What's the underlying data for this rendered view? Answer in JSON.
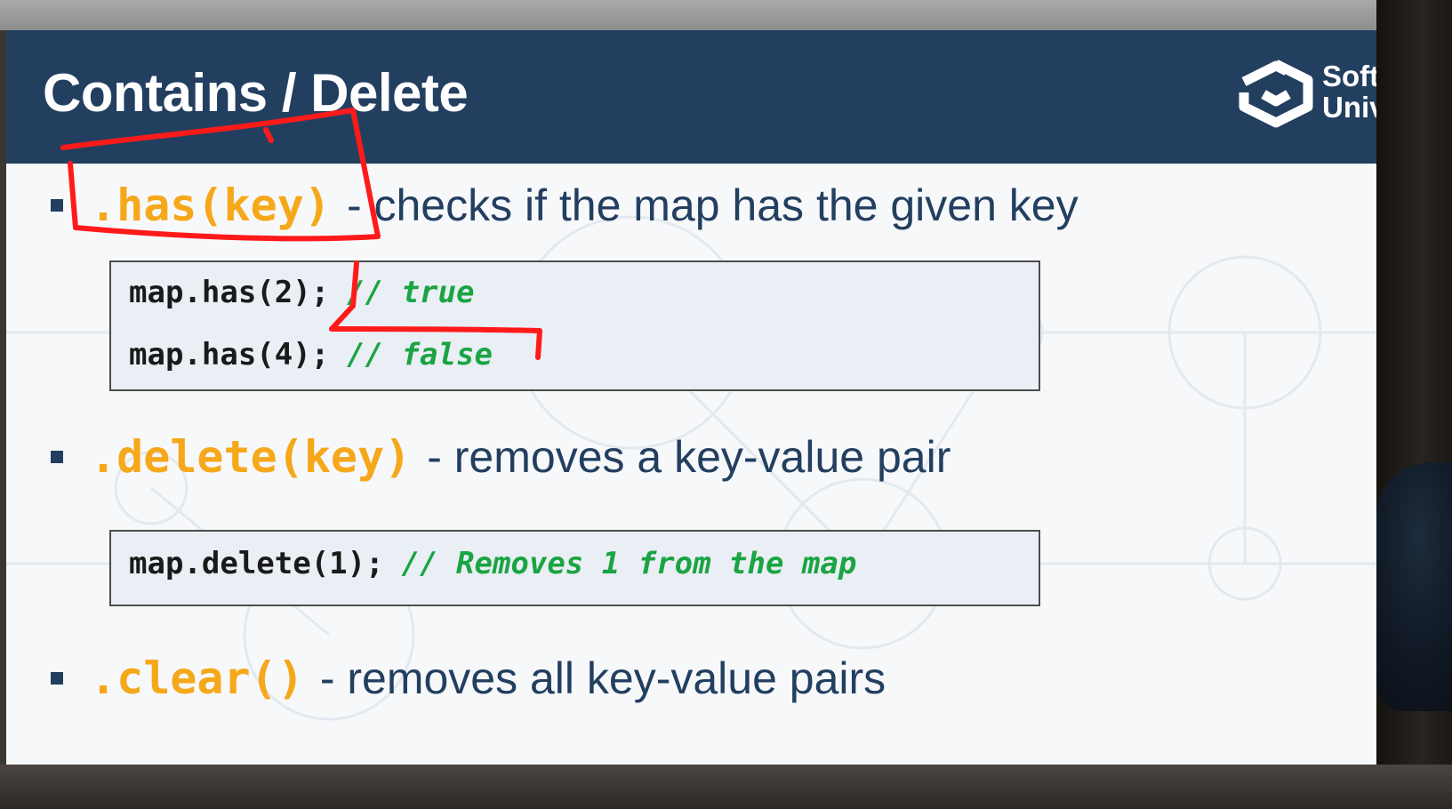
{
  "slide": {
    "title": "Contains / Delete",
    "logo_text": [
      "Soft",
      "Univ"
    ],
    "bullets": [
      {
        "method": ".has(key)",
        "description": "- checks if the map has the given key"
      },
      {
        "method": ".delete(key)",
        "description": "- removes a key-value pair"
      },
      {
        "method": ".clear()",
        "description": "- removes all key-value pairs"
      }
    ],
    "code_blocks": [
      {
        "lines": [
          {
            "code": "map.has(2);",
            "comment": "// true"
          },
          {
            "code": "map.has(4);",
            "comment": "// false"
          }
        ]
      },
      {
        "lines": [
          {
            "code": "map.delete(1);",
            "comment": "// Removes 1 from the map"
          }
        ]
      }
    ]
  },
  "colors": {
    "header_bg": "#233f60",
    "method": "#f6a81b",
    "comment": "#1aa442",
    "annotation": "#ff1a1a"
  },
  "icons": [
    "softuni-logo-icon",
    "bullet-square-icon"
  ]
}
